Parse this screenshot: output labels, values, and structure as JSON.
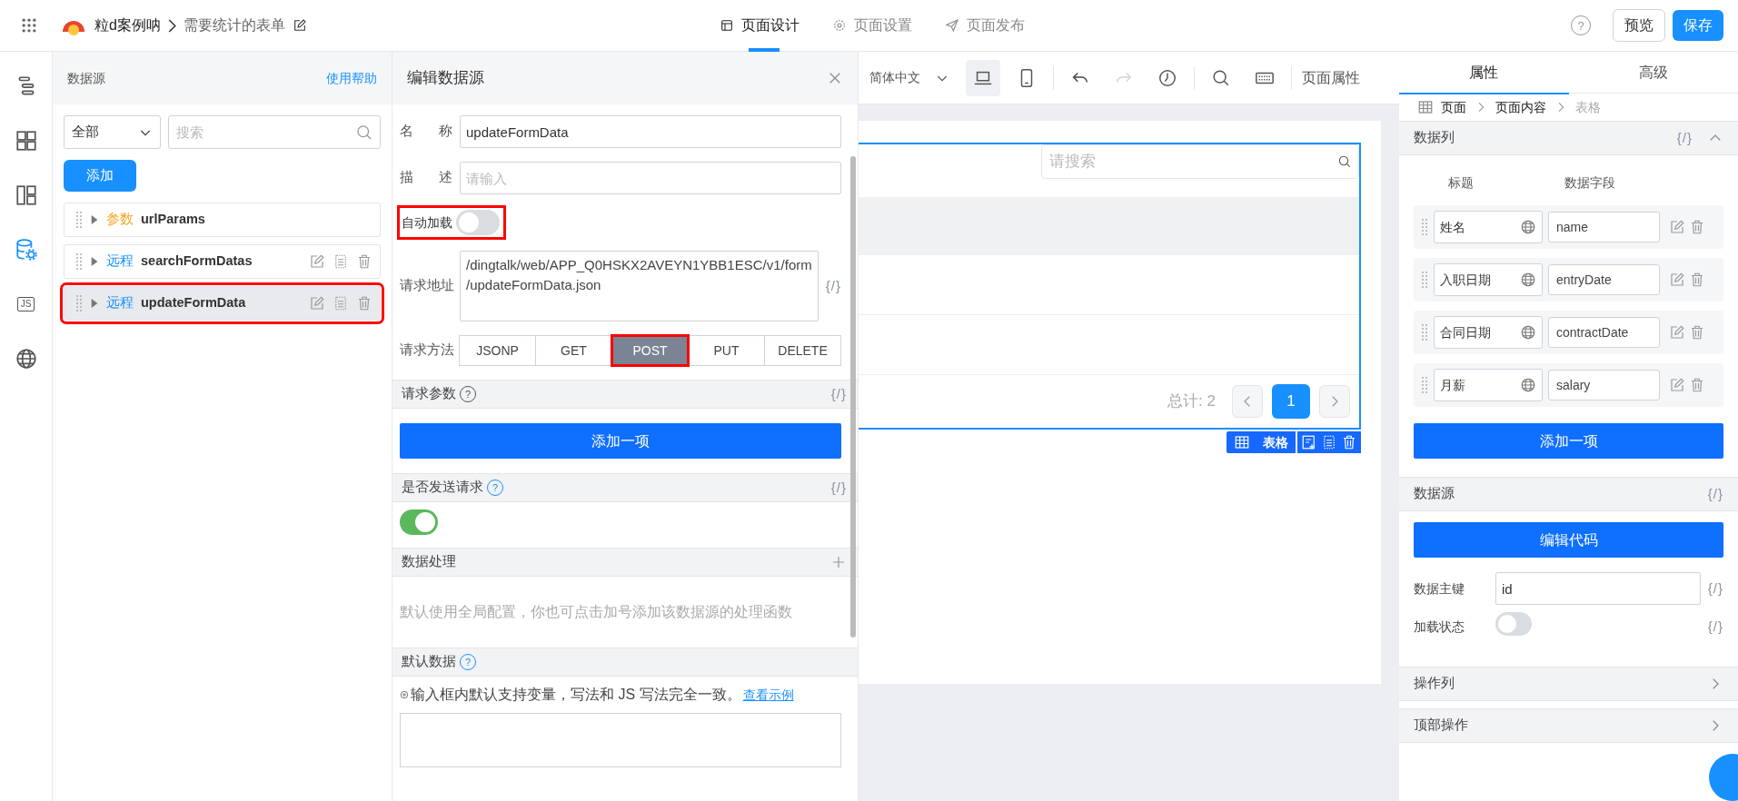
{
  "topbar": {
    "app_name": "粒d案例呐",
    "form_title": "需要统计的表单",
    "tabs": [
      {
        "label": "页面设计",
        "selected": true
      },
      {
        "label": "页面设置",
        "selected": false
      },
      {
        "label": "页面发布",
        "selected": false
      }
    ],
    "help": "?",
    "buttons": [
      {
        "label": "预览",
        "kind": "outline"
      },
      {
        "label": "保存",
        "kind": "primary"
      }
    ]
  },
  "rail": [
    {
      "selected": false
    },
    {
      "selected": false
    },
    {
      "selected": false
    },
    {
      "selected": true
    },
    {
      "selected": false,
      "label": "JS"
    },
    {
      "selected": false
    }
  ],
  "datasource_panel": {
    "title": "数据源",
    "help_link": "使用帮助",
    "filter": "全部",
    "search_placeholder": "搜索",
    "add_button": "添加",
    "items": [
      {
        "tag": "参数",
        "color": "#f5a623",
        "name": "urlParams",
        "actions": false,
        "selected": false,
        "highlighted": false
      },
      {
        "tag": "远程",
        "color": "#1890ff",
        "name": "searchFormDatas",
        "actions": true,
        "selected": false,
        "highlighted": false
      },
      {
        "tag": "远程",
        "color": "#1890ff",
        "name": "updateFormData",
        "actions": true,
        "selected": true,
        "highlighted": true
      }
    ]
  },
  "editor": {
    "title": "编辑数据源",
    "fields": [
      {
        "label": "名称",
        "value": "updateFormData"
      },
      {
        "label": "描述",
        "placeholder": "请输入"
      }
    ],
    "auto_load": {
      "label": "自动加载",
      "on": false,
      "highlighted": true
    },
    "url": {
      "label": "请求地址",
      "value": "/dingtalk/web/APP_Q0HSKX2AVEYN1YBB1ESC/v1/form/updateFormData.json",
      "code": "{/}"
    },
    "method": {
      "label": "请求方法",
      "options": [
        {
          "label": "JSONP",
          "selected": false,
          "highlighted": false
        },
        {
          "label": "GET",
          "selected": false,
          "highlighted": false
        },
        {
          "label": "POST",
          "selected": true,
          "highlighted": true
        },
        {
          "label": "PUT",
          "selected": false,
          "highlighted": false
        },
        {
          "label": "DELETE",
          "selected": false,
          "highlighted": false
        }
      ]
    },
    "sections": [
      {
        "kind": "button",
        "title": "请求参数",
        "help": "?",
        "code": "{/}",
        "button": "添加一项"
      },
      {
        "kind": "toggle",
        "title": "是否发送请求",
        "help": "?",
        "code": "{/}",
        "on": true
      },
      {
        "kind": "hint",
        "title": "数据处理",
        "hint": "默认使用全局配置，你也可点击加号添加该数据源的处理函数"
      },
      {
        "kind": "note",
        "title": "默认数据",
        "help": "?",
        "note": "输入框内默认支持变量，写法和 JS 写法完全一致。",
        "link": "查看示例"
      }
    ]
  },
  "canvas": {
    "language": "简体中文",
    "devices": [
      {
        "selected": true
      },
      {
        "selected": false
      }
    ],
    "history": [
      {
        "disabled": false
      },
      {
        "disabled": true
      }
    ],
    "page_props": "页面属性",
    "table": {
      "search_placeholder": "请搜索",
      "total": "总计: 2",
      "pages": [
        {
          "label": "1",
          "selected": true
        }
      ],
      "component_label": "表格"
    }
  },
  "properties": {
    "tabs": [
      {
        "label": "属性",
        "selected": true
      },
      {
        "label": "高级",
        "selected": false
      }
    ],
    "breadcrumb": [
      {
        "label": "页面",
        "current": false
      },
      {
        "label": "页面内容",
        "current": false
      },
      {
        "label": "表格",
        "current": true
      }
    ],
    "columns_section": {
      "title": "数据列",
      "code": "{/}",
      "expanded": true,
      "headers": [
        "标题",
        "数据字段"
      ],
      "rows": [
        {
          "title": "姓名",
          "field": "name"
        },
        {
          "title": "入职日期",
          "field": "entryDate"
        },
        {
          "title": "合同日期",
          "field": "contractDate"
        },
        {
          "title": "月薪",
          "field": "salary"
        }
      ],
      "add_button": "添加一项"
    },
    "datasource_section": {
      "title": "数据源",
      "code": "{/}",
      "button": "编辑代码",
      "fields": [
        {
          "kind": "input",
          "label": "数据主键",
          "value": "id",
          "code": "{/}"
        },
        {
          "kind": "toggle",
          "label": "加载状态",
          "on": false,
          "code": "{/}"
        }
      ]
    },
    "collapsed_sections": [
      {
        "title": "操作列",
        "expanded": false
      },
      {
        "title": "顶部操作",
        "expanded": false
      }
    ]
  }
}
